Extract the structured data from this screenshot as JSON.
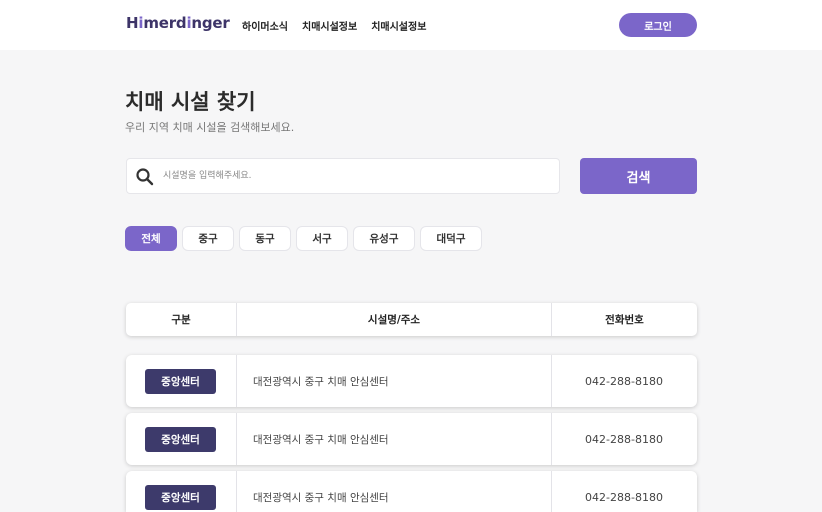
{
  "header": {
    "logo": {
      "part1": "H",
      "accent1": "i",
      "part2": "merd",
      "accent2": "i",
      "part3": "nger"
    },
    "nav": [
      "하이머소식",
      "치매시설정보",
      "치매시설정보"
    ],
    "login_label": "로그인"
  },
  "page": {
    "title": "치매 시설 찾기",
    "subtitle": "우리 지역 치매 시설을 검색해보세요."
  },
  "search": {
    "placeholder": "시설명을 입력해주세요.",
    "value": "",
    "button_label": "검색"
  },
  "filters": {
    "items": [
      "전체",
      "중구",
      "동구",
      "서구",
      "유성구",
      "대덕구"
    ],
    "active_index": 0
  },
  "table": {
    "headers": [
      "구분",
      "시설명/주소",
      "전화번호"
    ],
    "rows": [
      {
        "category": "중앙센터",
        "name": "대전광역시 중구 치매 안심센터",
        "phone": "042-288-8180"
      },
      {
        "category": "중앙센터",
        "name": "대전광역시 중구 치매 안심센터",
        "phone": "042-288-8180"
      },
      {
        "category": "중앙센터",
        "name": "대전광역시 중구 치매 안심센터",
        "phone": "042-288-8180"
      }
    ]
  },
  "colors": {
    "accent": "#7b66c9",
    "badge": "#3d3a6b",
    "background": "#f6f6f7"
  }
}
